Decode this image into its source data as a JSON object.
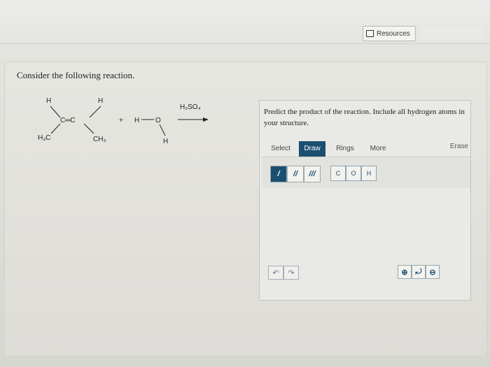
{
  "header": {
    "resources_label": "Resources"
  },
  "question": {
    "text": "Consider the following reaction."
  },
  "scheme": {
    "alkene": {
      "top_left": "H",
      "top_right": "H",
      "double_bond": "C═C",
      "bottom_left": "H₃C",
      "bottom_right": "CH₃"
    },
    "plus": "+",
    "water": {
      "h_left": "H",
      "oxygen": "O",
      "h_bottom": "H"
    },
    "reagent": "H₂SO₄"
  },
  "panel": {
    "prompt": "Predict the product of the reaction. Include all hydrogen atoms in your structure.",
    "tabs": [
      "Select",
      "Draw",
      "Rings",
      "More"
    ],
    "active_tab": "Draw",
    "erase_label": "Erase",
    "bond_tools": [
      "/",
      "//",
      "///"
    ],
    "atoms": [
      "C",
      "O",
      "H"
    ],
    "undo_glyph": "↶",
    "redo_glyph": "↷",
    "zoom_in_glyph": "⊕",
    "zoom_reset_glyph": "⤾",
    "zoom_out_glyph": "⊖"
  },
  "icons": {
    "resources": "book-icon",
    "undo": "undo-icon",
    "redo": "redo-icon",
    "zoom_in": "zoom-in-icon",
    "zoom_reset": "zoom-reset-icon",
    "zoom_out": "zoom-out-icon"
  },
  "colors": {
    "accent": "#1b4f6f",
    "panel_bg": "#e9e9e5"
  }
}
